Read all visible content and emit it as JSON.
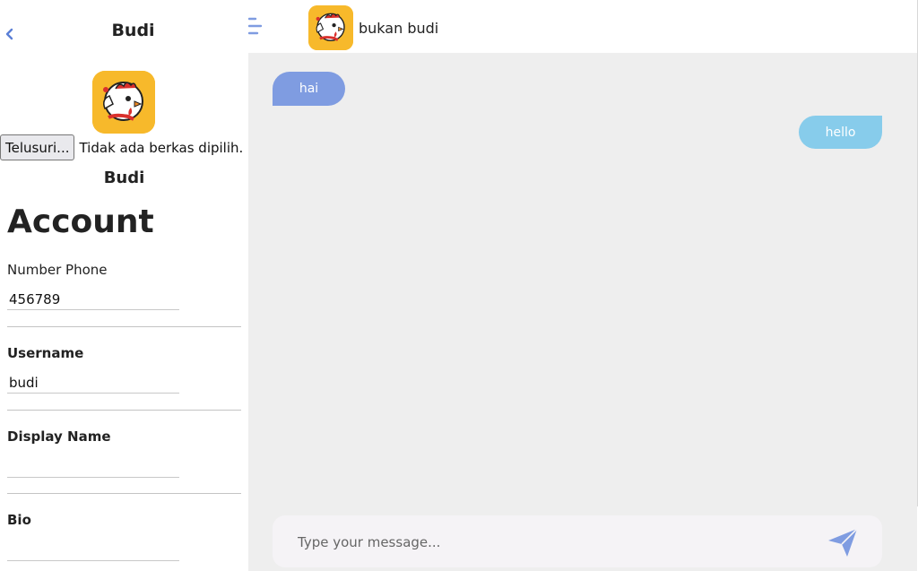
{
  "profile": {
    "header_name": "Budi",
    "file_button_label": "Telusuri...",
    "file_status": "Tidak ada berkas dipilih.",
    "display_name": "Budi",
    "section_title": "Account",
    "fields": [
      {
        "label": "Number Phone",
        "value": "456789"
      },
      {
        "label": "Username",
        "value": "budi"
      },
      {
        "label": "Display Name",
        "value": ""
      },
      {
        "label": "Bio",
        "value": ""
      }
    ]
  },
  "chat": {
    "contact_name": "bukan budi",
    "messages": [
      {
        "direction": "incoming",
        "text": "hai"
      },
      {
        "direction": "outgoing",
        "text": "hello"
      }
    ],
    "composer": {
      "placeholder": "Type your message..."
    }
  },
  "colors": {
    "accent": "#7f9ce1",
    "incoming_bubble": "#7f9ce1",
    "outgoing_bubble": "#87cceb",
    "avatar_bg": "#f7b92b",
    "chat_bg": "#eeeeee"
  },
  "icons": {
    "back": "chevron-left-icon",
    "menu": "menu-icon",
    "send": "paper-plane-icon",
    "avatar": "rooster-logo-icon"
  }
}
